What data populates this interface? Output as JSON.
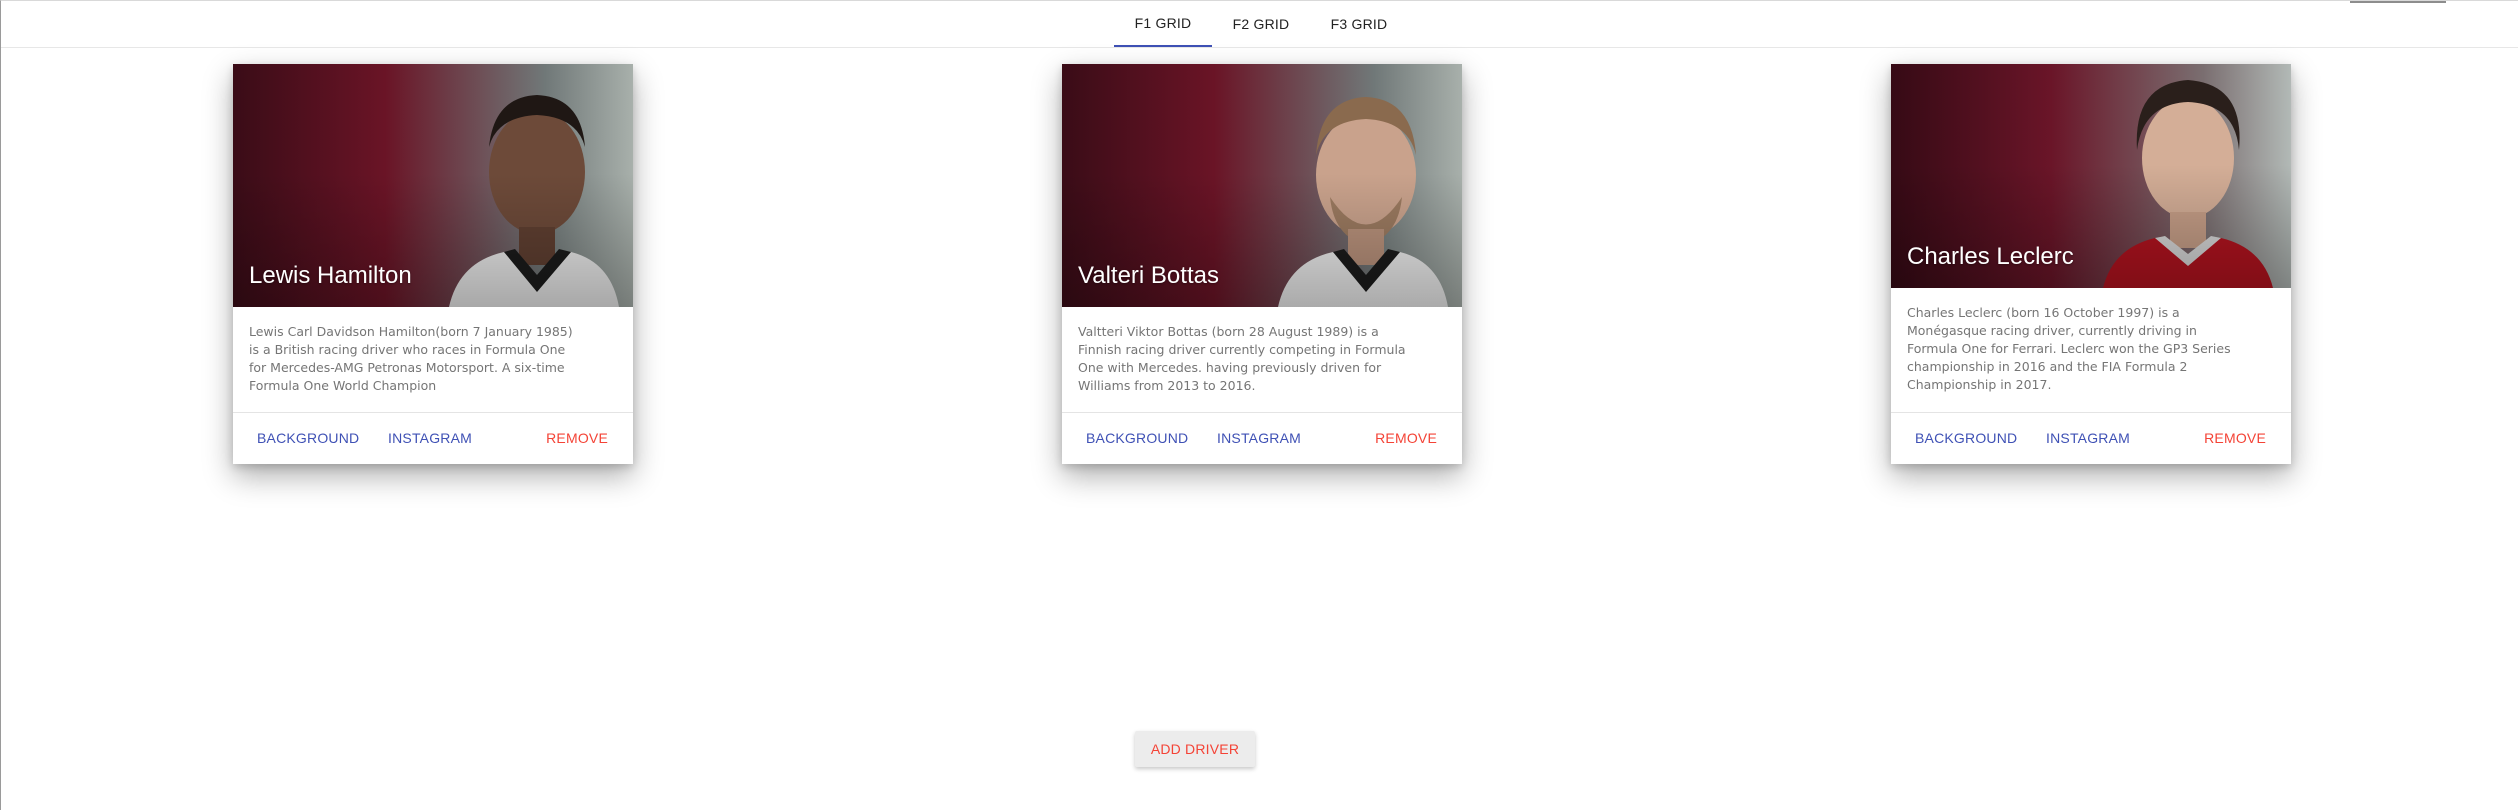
{
  "tabs": [
    {
      "label": "F1 GRID",
      "active": true
    },
    {
      "label": "F2 GRID",
      "active": false
    },
    {
      "label": "F3 GRID",
      "active": false
    }
  ],
  "colors": {
    "primary": "#3f51b5",
    "accent": "#f44336",
    "body_text": "#757575"
  },
  "drivers": [
    {
      "name": "Lewis Hamilton",
      "bio": "Lewis Carl Davidson Hamilton(born 7 January 1985) is a British racing driver who races in Formula One for Mercedes-AMG Petronas Motorsport. A six-time Formula One World Champion",
      "actions": {
        "background": "BACKGROUND",
        "instagram": "INSTAGRAM",
        "remove": "REMOVE"
      }
    },
    {
      "name": "Valteri Bottas",
      "bio": "Valtteri Viktor Bottas (born 28 August 1989) is a Finnish racing driver currently competing in Formula One with Mercedes. having previously driven for Williams from 2013 to 2016.",
      "actions": {
        "background": "BACKGROUND",
        "instagram": "INSTAGRAM",
        "remove": "REMOVE"
      }
    },
    {
      "name": "Charles Leclerc",
      "bio": "Charles Leclerc (born 16 October 1997) is a Monégasque racing driver, currently driving in Formula One for Ferrari. Leclerc won the GP3 Series championship in 2016 and the FIA Formula 2 Championship in 2017.",
      "actions": {
        "background": "BACKGROUND",
        "instagram": "INSTAGRAM",
        "remove": "REMOVE"
      }
    }
  ],
  "add_driver_label": "ADD DRIVER"
}
